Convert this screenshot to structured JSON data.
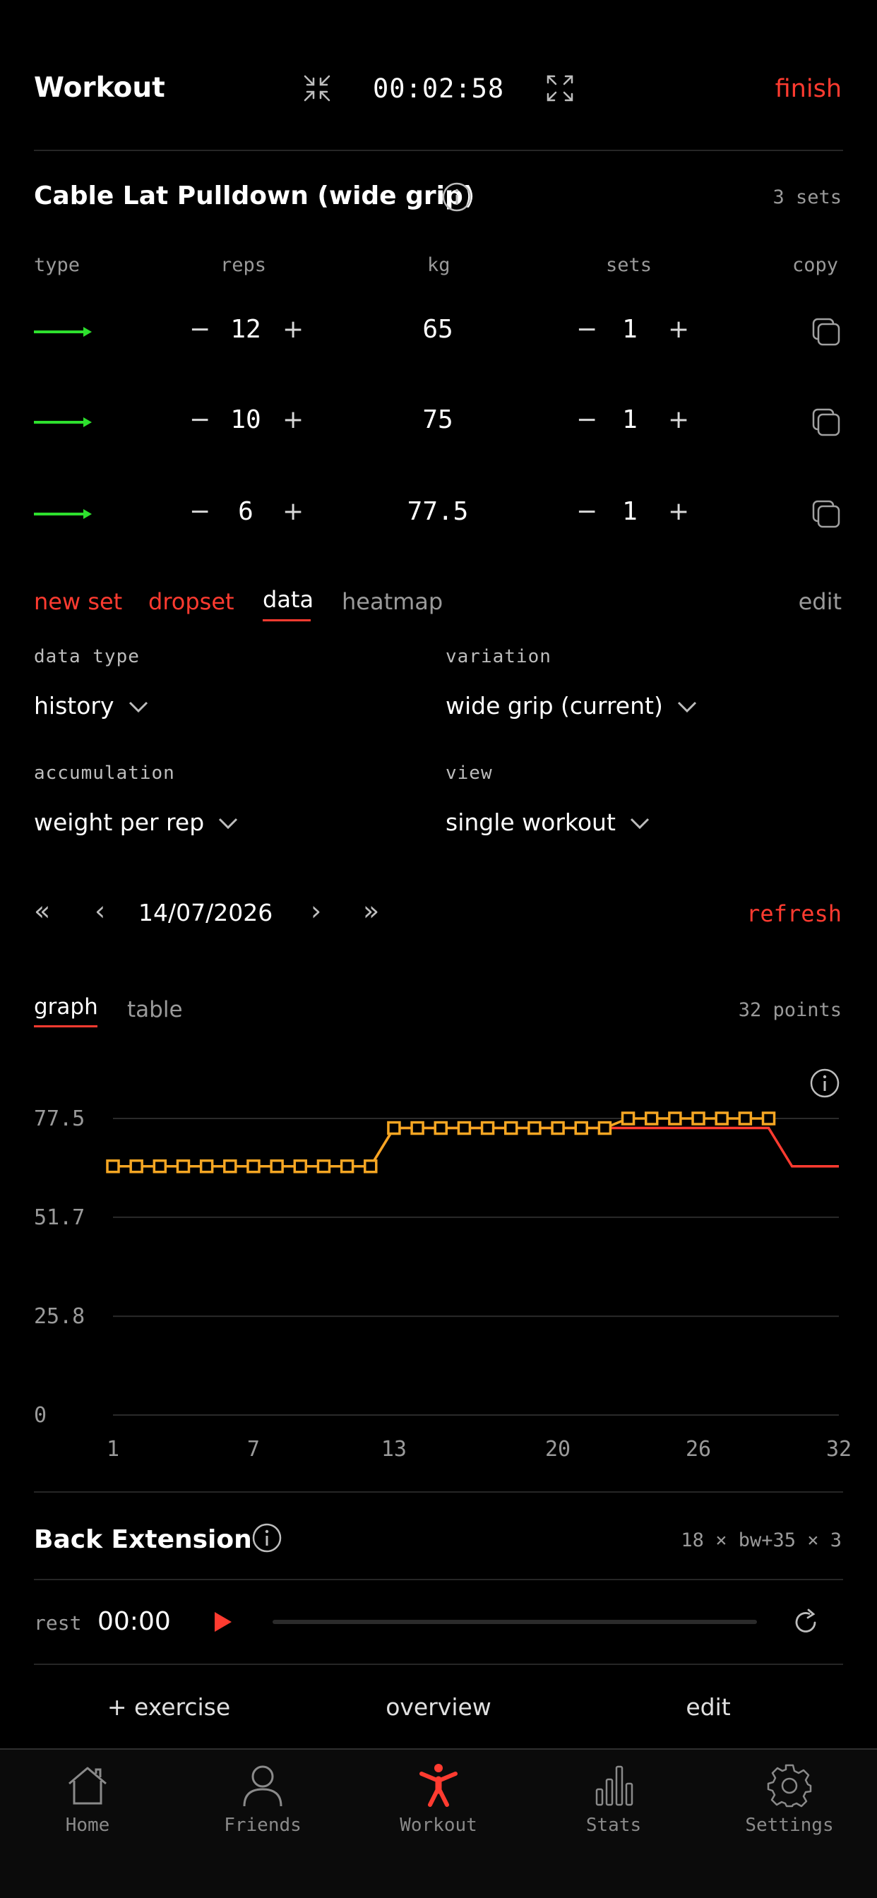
{
  "header": {
    "title": "Workout",
    "timer": "00:02:58",
    "finish_label": "finish",
    "icons": [
      "compress-icon",
      "expand-icon"
    ]
  },
  "exercise": {
    "name": "Cable Lat Pulldown (wide grip)",
    "sets_count": "3 sets",
    "columns": [
      "type",
      "reps",
      "kg",
      "sets",
      "copy"
    ],
    "rows": [
      {
        "reps": "12",
        "kg": "65",
        "sets": "1"
      },
      {
        "reps": "10",
        "kg": "75",
        "sets": "1"
      },
      {
        "reps": "6",
        "kg": "77.5",
        "sets": "1"
      }
    ],
    "minus": "−",
    "plus": "+"
  },
  "tabs": {
    "new_set": "new set",
    "dropset": "dropset",
    "data": "data",
    "heatmap": "heatmap",
    "edit": "edit"
  },
  "filters": {
    "data_type_label": "data type",
    "data_type_value": "history",
    "variation_label": "variation",
    "variation_value": "wide grip (current)",
    "accumulation_label": "accumulation",
    "accumulation_value": "weight per rep",
    "view_label": "view",
    "view_value": "single workout"
  },
  "date_nav": {
    "first": "«",
    "prev": "‹",
    "date": "14/07/2026",
    "next": "›",
    "last": "»",
    "refresh": "refresh"
  },
  "graph_tabs": {
    "graph": "graph",
    "table": "table",
    "points": "32 points"
  },
  "chart_data": {
    "type": "line",
    "x_ticks": [
      "1",
      "7",
      "13",
      "20",
      "26",
      "32"
    ],
    "y_ticks": [
      "0",
      "25.8",
      "51.7",
      "77.5"
    ],
    "ylim": [
      0,
      77.5
    ],
    "xlim": [
      1,
      32
    ],
    "grid": true,
    "series": [
      {
        "color": "#ff3b30",
        "x": [
          1,
          2,
          3,
          4,
          5,
          6,
          7,
          8,
          9,
          10,
          11,
          12,
          13,
          14,
          15,
          16,
          17,
          18,
          19,
          20,
          21,
          22,
          23,
          24,
          25,
          26,
          27,
          28,
          29,
          30,
          31,
          32
        ],
        "values": [
          65,
          65,
          65,
          65,
          65,
          65,
          65,
          65,
          65,
          65,
          65,
          65,
          75,
          75,
          75,
          75,
          75,
          75,
          75,
          75,
          75,
          75,
          75,
          75,
          75,
          75,
          75,
          75,
          75,
          65,
          65,
          65
        ]
      },
      {
        "color": "#f5a623",
        "x": [
          1,
          2,
          3,
          4,
          5,
          6,
          7,
          8,
          9,
          10,
          11,
          12,
          13,
          14,
          15,
          16,
          17,
          18,
          19,
          20,
          21,
          22,
          23,
          24,
          25,
          26,
          27,
          28,
          29
        ],
        "values": [
          65,
          65,
          65,
          65,
          65,
          65,
          65,
          65,
          65,
          65,
          65,
          65,
          75,
          75,
          75,
          75,
          75,
          75,
          75,
          75,
          75,
          75,
          77.5,
          77.5,
          77.5,
          77.5,
          77.5,
          77.5,
          77.5
        ]
      }
    ]
  },
  "next_exercise": {
    "name": "Back Extension",
    "summary": "18 × bw+35 × 3"
  },
  "rest": {
    "label": "rest",
    "time": "00:00",
    "progress": 0
  },
  "actions": {
    "add_exercise": "+ exercise",
    "overview": "overview",
    "edit": "edit"
  },
  "nav": {
    "items": [
      "Home",
      "Friends",
      "Workout",
      "Stats",
      "Settings"
    ],
    "active": "Workout",
    "accent": "#ff3b30"
  }
}
